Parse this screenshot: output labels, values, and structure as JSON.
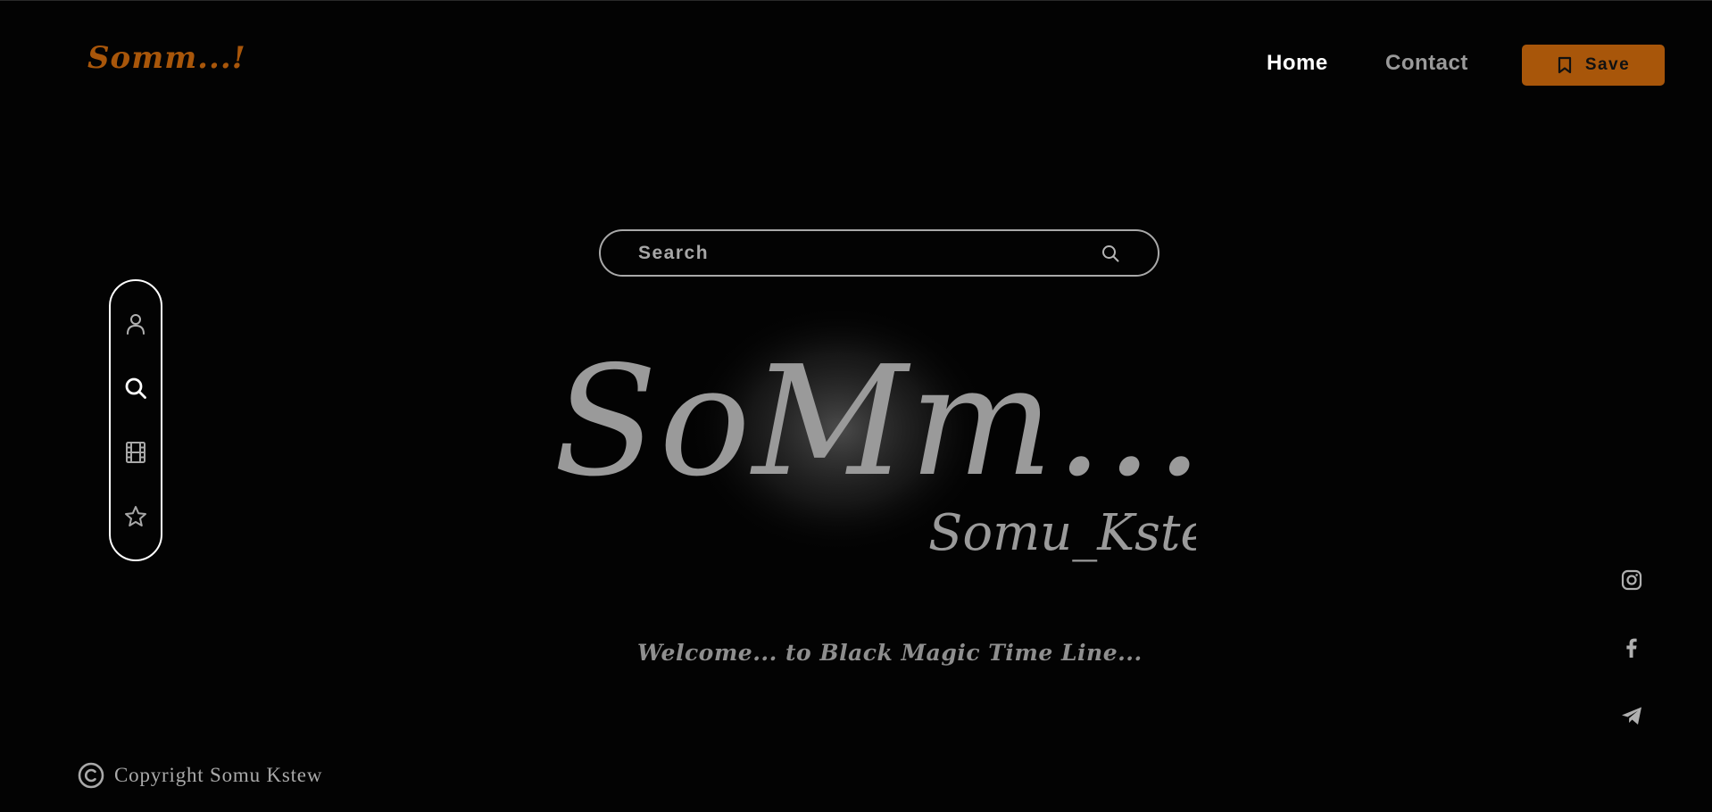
{
  "header": {
    "brand": "Somm...!",
    "nav": {
      "home": "Home",
      "contact": "Contact"
    },
    "save_label": "Save"
  },
  "search": {
    "placeholder": "Search"
  },
  "sidebar": {
    "items": [
      {
        "icon": "user-icon"
      },
      {
        "icon": "search-icon"
      },
      {
        "icon": "film-icon"
      },
      {
        "icon": "star-icon"
      }
    ]
  },
  "hero": {
    "logo_main": "SoMm...!",
    "logo_sub": "Somu_Kstew",
    "welcome": "Welcome... to  Black Magic Time Line..."
  },
  "social": [
    {
      "icon": "instagram-icon"
    },
    {
      "icon": "facebook-icon"
    },
    {
      "icon": "telegram-icon"
    }
  ],
  "footer": {
    "copyright": "Copyright Somu Kstew"
  },
  "colors": {
    "accent": "#a8560a",
    "background": "#030303",
    "muted": "#9a9a9a"
  }
}
